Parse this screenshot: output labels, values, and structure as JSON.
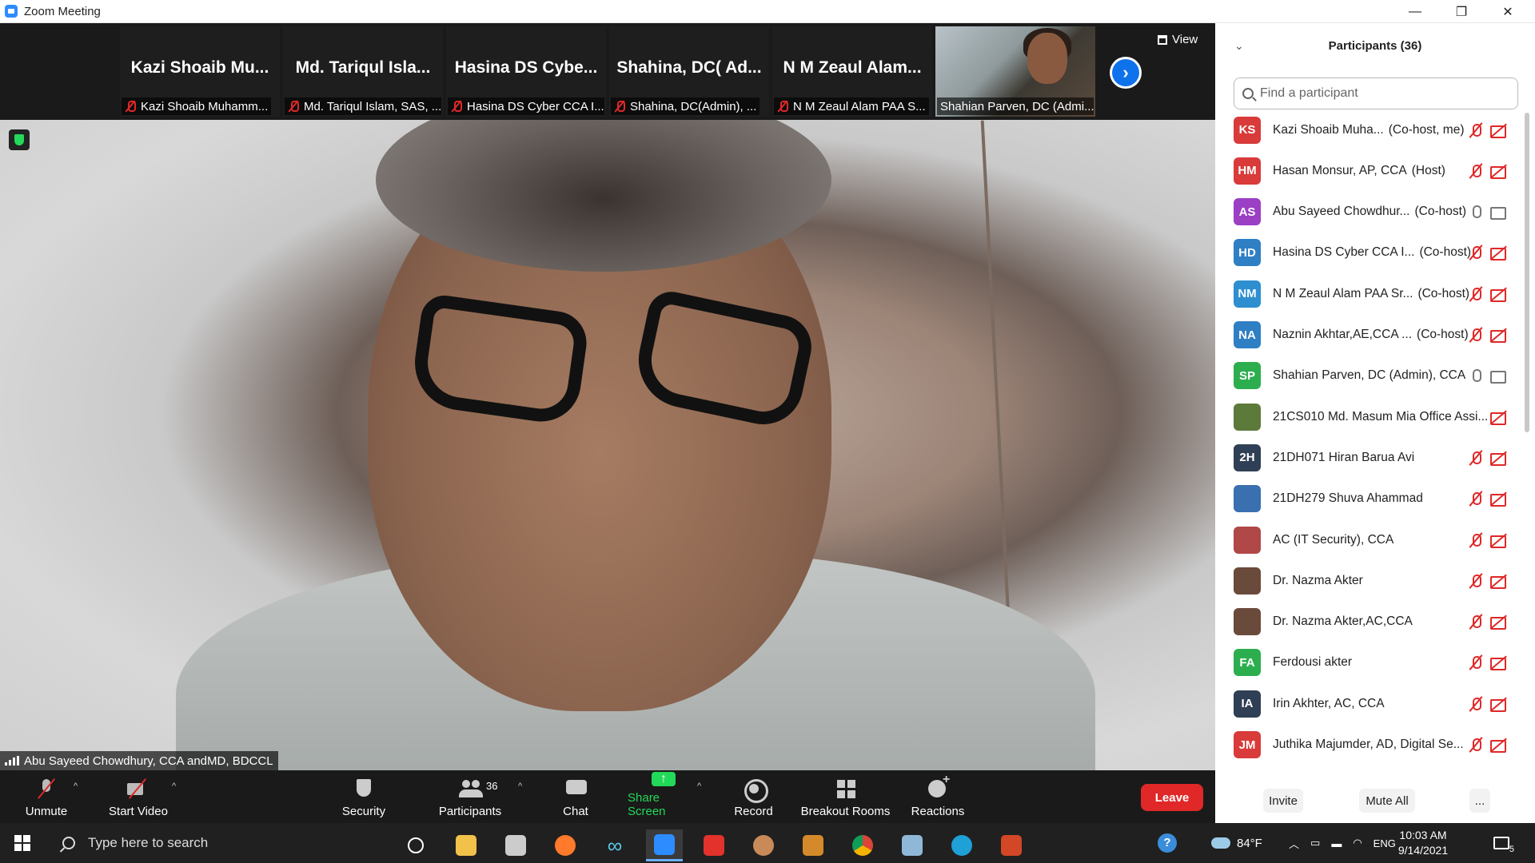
{
  "window": {
    "title": "Zoom Meeting",
    "controls": [
      "—",
      "❐",
      "✕"
    ]
  },
  "strip": {
    "view_label": "View",
    "tiles": [
      {
        "display_name": "Kazi Shoaib Mu...",
        "label": "Kazi Shoaib Muhamm..."
      },
      {
        "display_name": "Md. Tariqul Isla...",
        "label": "Md. Tariqul Islam, SAS, ..."
      },
      {
        "display_name": "Hasina DS Cybe...",
        "label": "Hasina DS Cyber CCA I..."
      },
      {
        "display_name": "Shahina, DC( Ad...",
        "label": "Shahina, DC(Admin), ..."
      },
      {
        "display_name": "N M Zeaul Alam...",
        "label": "N M Zeaul Alam PAA S..."
      },
      {
        "display_name": "",
        "label": "Shahian Parven, DC (Admi..."
      }
    ]
  },
  "main": {
    "speaker_label": "Abu Sayeed Chowdhury, CCA andMD, BDCCL"
  },
  "toolbar": {
    "unmute": "Unmute",
    "start_video": "Start Video",
    "security": "Security",
    "participants": "Participants",
    "participants_count": "36",
    "chat": "Chat",
    "share_screen": "Share Screen",
    "record": "Record",
    "breakout_rooms": "Breakout Rooms",
    "reactions": "Reactions",
    "leave": "Leave"
  },
  "panel": {
    "title": "Participants (36)",
    "search_placeholder": "Find a participant",
    "invite": "Invite",
    "mute_all": "Mute All",
    "more": "...",
    "participants": [
      {
        "initials": "KS",
        "color": "#d93a3a",
        "name": "Kazi Shoaib Muha...",
        "role": "(Co-host, me)",
        "mic": "off",
        "cam": "off"
      },
      {
        "initials": "HM",
        "color": "#d93a3a",
        "name": "Hasan Monsur, AP, CCA",
        "role": "(Host)",
        "mic": "off",
        "cam": "off"
      },
      {
        "initials": "AS",
        "color": "#9b3fc4",
        "name": "Abu Sayeed Chowdhur...",
        "role": "(Co-host)",
        "mic": "on",
        "cam": "on"
      },
      {
        "initials": "HD",
        "color": "#2e7fc4",
        "name": "Hasina DS Cyber CCA I...",
        "role": "(Co-host)",
        "mic": "off",
        "cam": "off"
      },
      {
        "initials": "NM",
        "color": "#2e8fd0",
        "name": "N M Zeaul Alam PAA Sr...",
        "role": "(Co-host)",
        "mic": "off",
        "cam": "off"
      },
      {
        "initials": "NA",
        "color": "#2e7fc4",
        "name": "Naznin Akhtar,AE,CCA ...",
        "role": "(Co-host)",
        "mic": "off",
        "cam": "off"
      },
      {
        "initials": "SP",
        "color": "#2cae4e",
        "name": "Shahian Parven, DC (Admin), CCA",
        "role": "",
        "mic": "on",
        "cam": "on"
      },
      {
        "initials": "",
        "color": "#5c7a3a",
        "name": "21CS010 Md. Masum Mia Office Assi...",
        "role": "",
        "mic": "none",
        "cam": "off"
      },
      {
        "initials": "2H",
        "color": "#2f3f55",
        "name": "21DH071 Hiran Barua Avi",
        "role": "",
        "mic": "off",
        "cam": "off"
      },
      {
        "initials": "",
        "color": "#3a6fb0",
        "name": "21DH279 Shuva Ahammad",
        "role": "",
        "mic": "off",
        "cam": "off"
      },
      {
        "initials": "",
        "color": "#b04848",
        "name": "AC (IT Security), CCA",
        "role": "",
        "mic": "off",
        "cam": "off"
      },
      {
        "initials": "",
        "color": "#6a4a3a",
        "name": "Dr. Nazma Akter",
        "role": "",
        "mic": "off",
        "cam": "off"
      },
      {
        "initials": "",
        "color": "#6a4a3a",
        "name": "Dr. Nazma Akter,AC,CCA",
        "role": "",
        "mic": "off",
        "cam": "off"
      },
      {
        "initials": "FA",
        "color": "#2cae4e",
        "name": "Ferdousi akter",
        "role": "",
        "mic": "off",
        "cam": "off"
      },
      {
        "initials": "IA",
        "color": "#2f3f55",
        "name": "Irin Akhter, AC, CCA",
        "role": "",
        "mic": "off",
        "cam": "off"
      },
      {
        "initials": "JM",
        "color": "#d93a3a",
        "name": "Juthika Majumder, AD,  Digital Se...",
        "role": "",
        "mic": "off",
        "cam": "off"
      }
    ]
  },
  "taskbar": {
    "search_placeholder": "Type here to search",
    "weather": "84°F",
    "language": "ENG",
    "time": "10:03 AM",
    "date": "9/14/2021",
    "notifications": "5"
  }
}
